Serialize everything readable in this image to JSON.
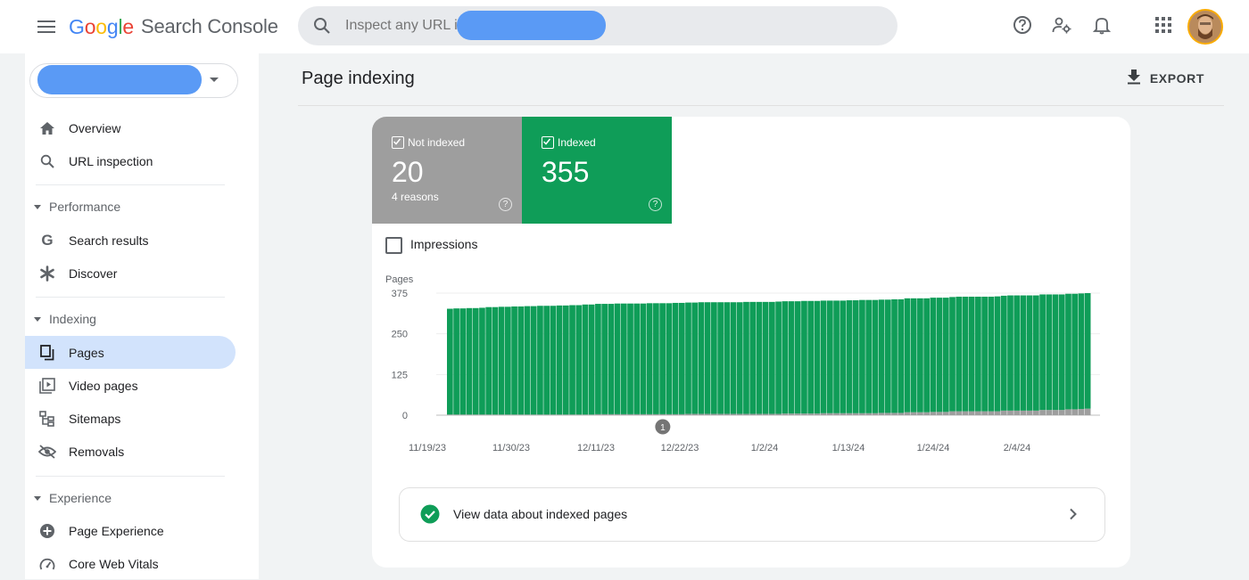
{
  "app": {
    "logo_letters": [
      "G",
      "o",
      "o",
      "g",
      "l",
      "e"
    ],
    "product": "Search Console"
  },
  "search": {
    "placeholder": "Inspect any URL in"
  },
  "colors": {
    "accent": "#1a73e8",
    "indexed": "#0f9d58",
    "not_indexed": "#9e9e9e",
    "active_nav": "#d2e3fc",
    "redaction": "#5a9af5"
  },
  "topbar_icons": [
    "menu-icon",
    "search-icon",
    "help-icon",
    "manage-users-icon",
    "notifications-icon",
    "apps-icon"
  ],
  "sidebar": {
    "items_top": [
      {
        "label": "Overview",
        "icon": "home-icon"
      },
      {
        "label": "URL inspection",
        "icon": "search-icon"
      }
    ],
    "sections": [
      {
        "label": "Performance",
        "items": [
          {
            "label": "Search results",
            "icon": "google-g-icon"
          },
          {
            "label": "Discover",
            "icon": "asterisk-icon"
          }
        ]
      },
      {
        "label": "Indexing",
        "items": [
          {
            "label": "Pages",
            "icon": "pages-icon",
            "active": true
          },
          {
            "label": "Video pages",
            "icon": "video-pages-icon"
          },
          {
            "label": "Sitemaps",
            "icon": "sitemap-icon"
          },
          {
            "label": "Removals",
            "icon": "eye-off-icon"
          }
        ]
      },
      {
        "label": "Experience",
        "items": [
          {
            "label": "Page Experience",
            "icon": "add-circle-icon"
          },
          {
            "label": "Core Web Vitals",
            "icon": "speed-icon"
          }
        ]
      }
    ]
  },
  "main": {
    "title": "Page indexing",
    "export_label": "EXPORT",
    "tiles": {
      "not_indexed": {
        "label": "Not indexed",
        "value": "20",
        "sub": "4 reasons",
        "help": "?"
      },
      "indexed": {
        "label": "Indexed",
        "value": "355",
        "help": "?"
      }
    },
    "impressions_label": "Impressions",
    "indexed_link_label": "View data about indexed pages"
  },
  "chart_data": {
    "type": "bar",
    "stacked": true,
    "ylabel": "Pages",
    "ylim": [
      0,
      375
    ],
    "yticks": [
      0,
      125,
      250,
      375
    ],
    "xtick_labels": [
      "11/19/23",
      "11/30/23",
      "12/11/23",
      "12/22/23",
      "1/2/24",
      "1/13/24",
      "1/24/24",
      "2/4/24"
    ],
    "annotation": "1",
    "annotation_index": 33,
    "series": [
      {
        "name": "Indexed",
        "color": "#0f9d58",
        "values": [
          325,
          326,
          326,
          327,
          327,
          328,
          330,
          330,
          331,
          331,
          332,
          332,
          333,
          333,
          334,
          334,
          334,
          335,
          335,
          336,
          336,
          338,
          338,
          339,
          339,
          339,
          340,
          340,
          340,
          340,
          340,
          341,
          341,
          341,
          341,
          342,
          342,
          342,
          342,
          343,
          343,
          343,
          343,
          343,
          343,
          343,
          344,
          344,
          344,
          344,
          344,
          345,
          345,
          345,
          345,
          346,
          346,
          346,
          346,
          346,
          346,
          346,
          347,
          347,
          348,
          348,
          348,
          348,
          348,
          349,
          349,
          350,
          350,
          350,
          350,
          351,
          351,
          351,
          351,
          352,
          352,
          352,
          352,
          352,
          352,
          353,
          353,
          354,
          354,
          354,
          354,
          354,
          355,
          355,
          355,
          355,
          355,
          355,
          355,
          355
        ]
      },
      {
        "name": "Not indexed",
        "color": "#9e9e9e",
        "values": [
          2,
          2,
          2,
          2,
          2,
          2,
          2,
          2,
          2,
          2,
          2,
          2,
          2,
          2,
          2,
          2,
          2,
          2,
          2,
          2,
          2,
          2,
          2,
          3,
          3,
          3,
          3,
          3,
          3,
          3,
          3,
          3,
          3,
          3,
          3,
          3,
          3,
          4,
          4,
          4,
          4,
          4,
          4,
          4,
          4,
          4,
          4,
          4,
          4,
          4,
          4,
          4,
          5,
          5,
          5,
          5,
          5,
          5,
          6,
          6,
          6,
          6,
          6,
          6,
          6,
          6,
          6,
          7,
          7,
          7,
          7,
          9,
          9,
          9,
          9,
          10,
          10,
          10,
          12,
          12,
          12,
          12,
          12,
          12,
          12,
          12,
          14,
          14,
          14,
          14,
          14,
          14,
          16,
          16,
          16,
          16,
          18,
          18,
          19,
          20
        ]
      }
    ]
  }
}
